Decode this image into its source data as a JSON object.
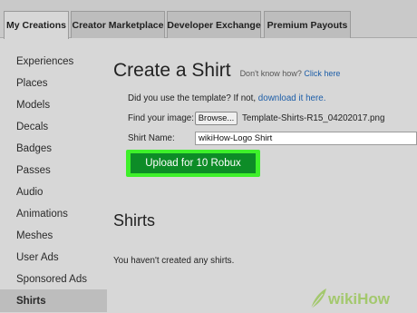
{
  "tabs": [
    {
      "label": "My Creations"
    },
    {
      "label": "Creator Marketplace"
    },
    {
      "label": "Developer Exchange"
    },
    {
      "label": "Premium Payouts"
    }
  ],
  "sidebar": {
    "items": [
      {
        "label": "Experiences"
      },
      {
        "label": "Places"
      },
      {
        "label": "Models"
      },
      {
        "label": "Decals"
      },
      {
        "label": "Badges"
      },
      {
        "label": "Passes"
      },
      {
        "label": "Audio"
      },
      {
        "label": "Animations"
      },
      {
        "label": "Meshes"
      },
      {
        "label": "User Ads"
      },
      {
        "label": "Sponsored Ads"
      },
      {
        "label": "Shirts"
      }
    ],
    "active": "Shirts"
  },
  "main": {
    "title": "Create a Shirt",
    "help_text": "Don't know how?",
    "help_link": "Click here",
    "template_text": "Did you use the template? If not,",
    "template_link": "download it here.",
    "find_image_label": "Find your image:",
    "browse_label": "Browse...",
    "file_name": "Template-Shirts-R15_04202017.png",
    "shirt_name_label": "Shirt Name:",
    "shirt_name_value": "wikiHow-Logo Shirt",
    "upload_label": "Upload for 10 Robux",
    "section_title": "Shirts",
    "empty_text": "You haven't created any shirts."
  },
  "watermark": {
    "wiki": "wiki",
    "how": "How"
  },
  "colors": {
    "upload_bg": "#0d8c27",
    "upload_highlight": "#3ef02a",
    "link": "#1d5ea8"
  }
}
